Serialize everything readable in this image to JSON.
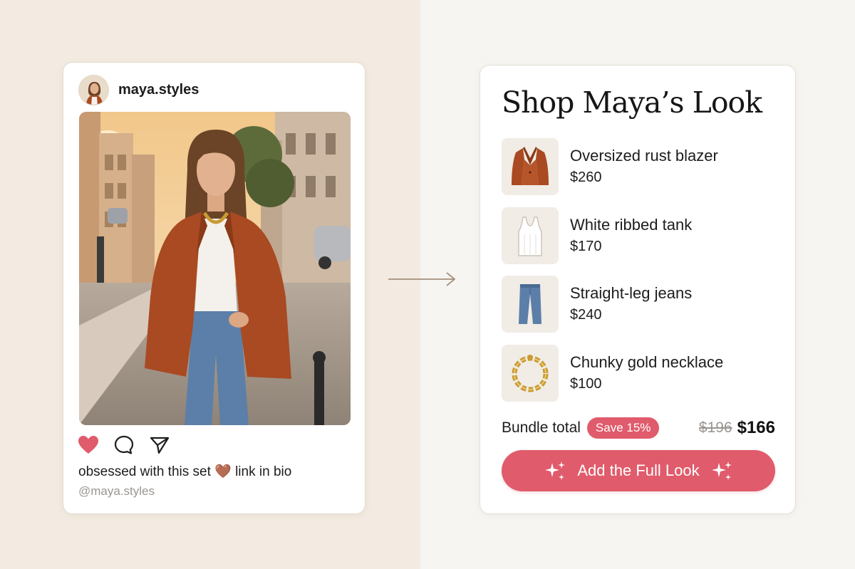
{
  "post": {
    "username": "maya.styles",
    "caption": "obsessed with this set 🤎 link in bio",
    "handle": "@maya.styles",
    "liked": true,
    "icons": [
      "heart-icon",
      "comment-icon",
      "share-icon"
    ]
  },
  "shop": {
    "title": "Shop Maya’s Look",
    "products": [
      {
        "name": "Oversized rust blazer",
        "price": "$260",
        "icon": "blazer-icon"
      },
      {
        "name": "White ribbed tank",
        "price": "$170",
        "icon": "tank-top-icon"
      },
      {
        "name": "Straight-leg jeans",
        "price": "$240",
        "icon": "jeans-icon"
      },
      {
        "name": "Chunky gold necklace",
        "price": "$100",
        "icon": "necklace-icon"
      }
    ],
    "bundle": {
      "label": "Bundle total",
      "badge": "Save 15%",
      "old_price": "$196",
      "new_price": "$166"
    },
    "cta_label": "Add the Full Look"
  },
  "colors": {
    "accent": "#e05b6b",
    "rust": "#a94a22",
    "denim": "#5b7fa8",
    "gold": "#c99a35"
  }
}
